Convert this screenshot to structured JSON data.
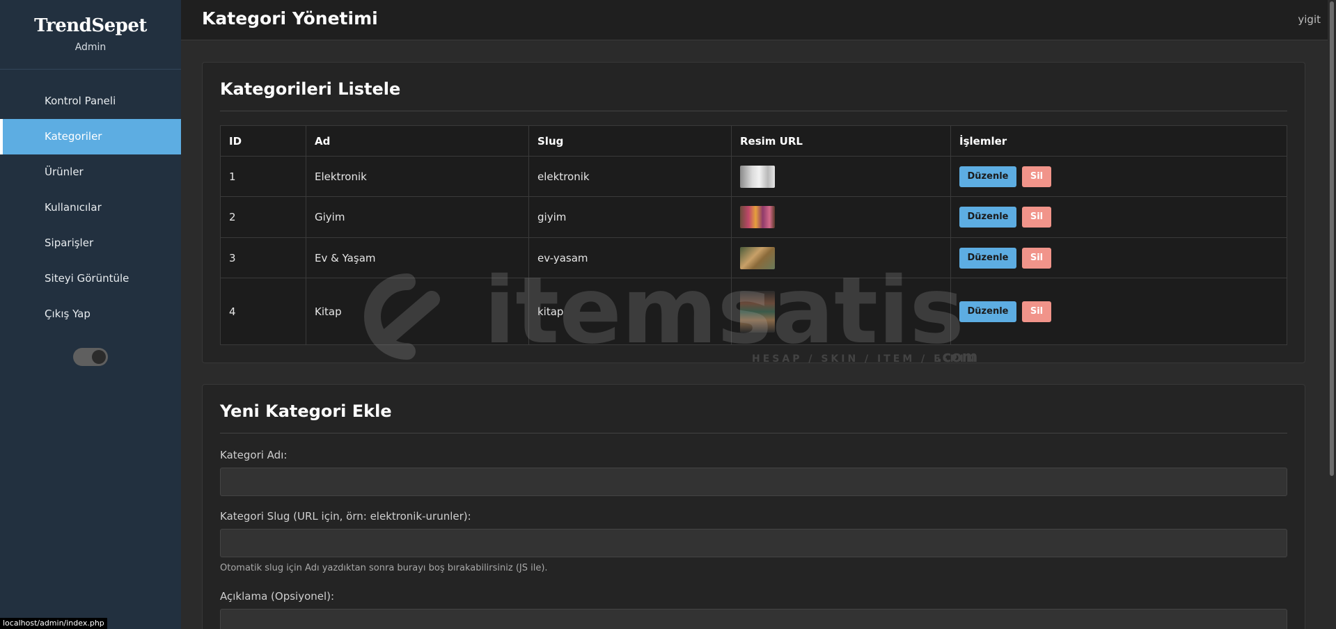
{
  "sidebar": {
    "brand": "TrendSepet",
    "subtitle": "Admin",
    "items": [
      {
        "label": "Kontrol Paneli",
        "active": false
      },
      {
        "label": "Kategoriler",
        "active": true
      },
      {
        "label": "Ürünler",
        "active": false
      },
      {
        "label": "Kullanıcılar",
        "active": false
      },
      {
        "label": "Siparişler",
        "active": false
      },
      {
        "label": "Siteyi Görüntüle",
        "active": false
      },
      {
        "label": "Çıkış Yap",
        "active": false
      }
    ],
    "theme_toggle": "on"
  },
  "header": {
    "title": "Kategori Yönetimi",
    "user": "yigit"
  },
  "list": {
    "title": "Kategorileri Listele",
    "columns": [
      "ID",
      "Ad",
      "Slug",
      "Resim URL",
      "İşlemler"
    ],
    "rows": [
      {
        "id": "1",
        "name": "Elektronik",
        "slug": "elektronik"
      },
      {
        "id": "2",
        "name": "Giyim",
        "slug": "giyim"
      },
      {
        "id": "3",
        "name": "Ev & Yaşam",
        "slug": "ev-yasam"
      },
      {
        "id": "4",
        "name": "Kitap",
        "slug": "kitap"
      }
    ],
    "edit_label": "Düzenle",
    "delete_label": "Sil"
  },
  "form": {
    "title": "Yeni Kategori Ekle",
    "name_label": "Kategori Adı:",
    "name_value": "",
    "slug_label": "Kategori Slug (URL için, örn: elektronik-urunler):",
    "slug_value": "",
    "slug_hint": "Otomatik slug için Adı yazdıktan sonra burayı boş bırakabilirsiniz (JS ile).",
    "desc_label": "Açıklama (Opsiyonel):",
    "desc_value": ""
  },
  "watermark": {
    "brand": "itemsatis",
    "tagline": "HESAP / SKIN / ITEM / E-PIN",
    "suffix": ".com"
  },
  "statusbar": {
    "url": "localhost/admin/index.php"
  },
  "colors": {
    "accent": "#5dade2",
    "danger": "#f1948a",
    "sidebar": "#22303f"
  }
}
